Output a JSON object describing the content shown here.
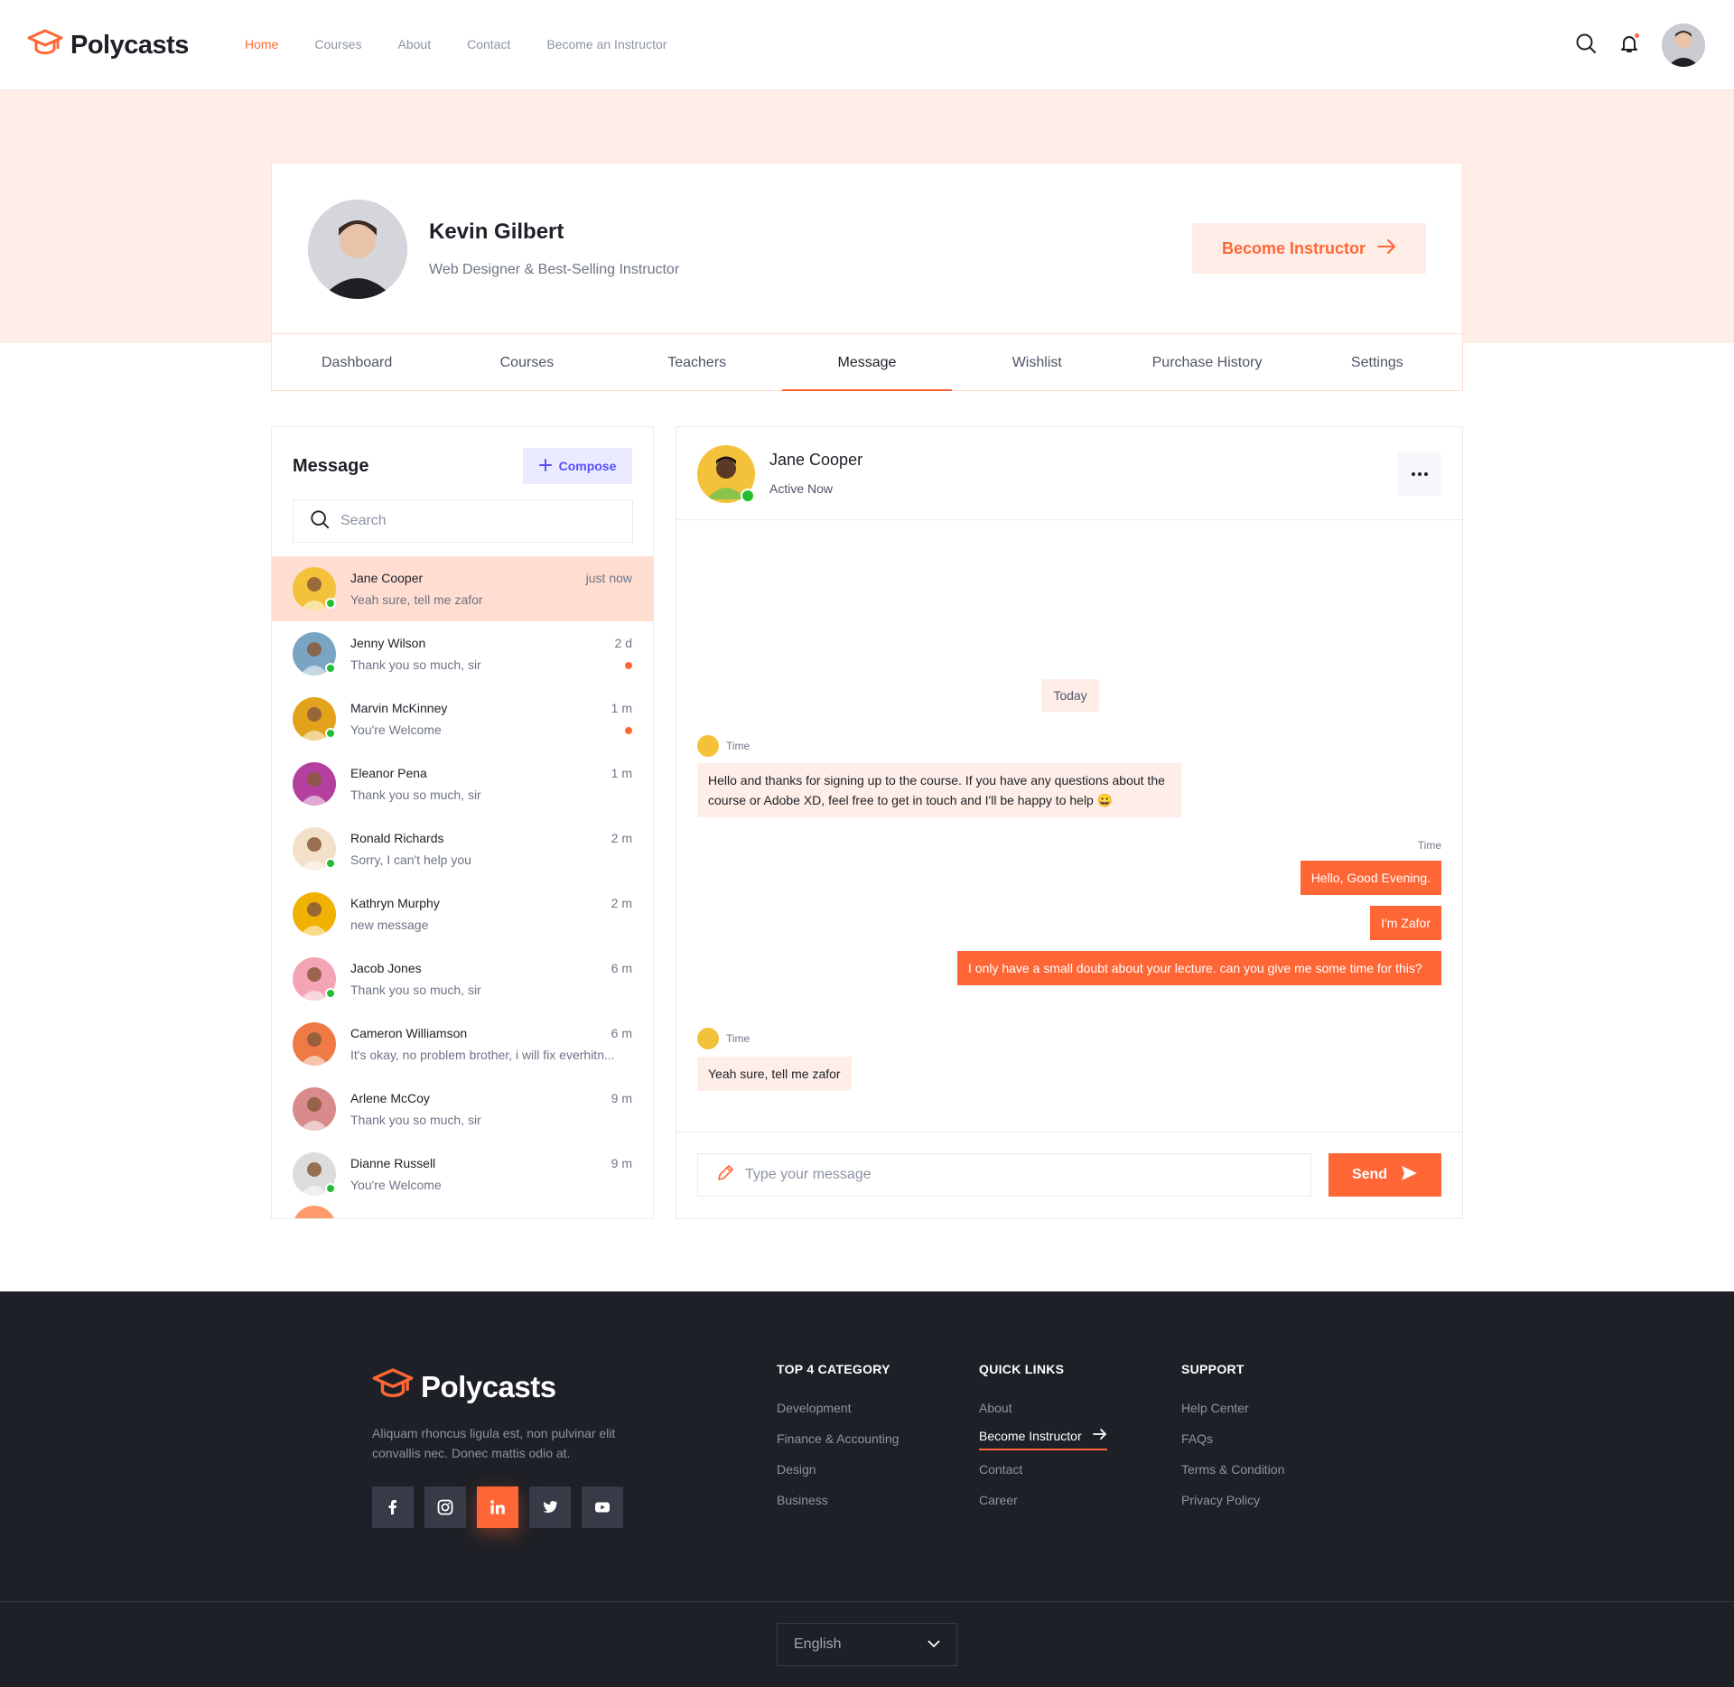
{
  "brand": {
    "name": "Polycasts",
    "accent": "#ff6636"
  },
  "nav": {
    "items": [
      "Home",
      "Courses",
      "About",
      "Contact",
      "Become an Instructor"
    ],
    "active": "Home"
  },
  "header_icons": [
    "search-icon",
    "bell-icon",
    "avatar"
  ],
  "profile": {
    "name": "Kevin Gilbert",
    "role": "Web Designer & Best-Selling Instructor",
    "cta": "Become Instructor"
  },
  "tabs": {
    "items": [
      "Dashboard",
      "Courses",
      "Teachers",
      "Message",
      "Wishlist",
      "Purchase History",
      "Settings"
    ],
    "active": "Message"
  },
  "messages": {
    "title": "Message",
    "compose": "Compose",
    "search_placeholder": "Search",
    "contacts": [
      {
        "name": "Jane Cooper",
        "time": "just now",
        "preview": "Yeah sure, tell me zafor",
        "online": true,
        "unread": false,
        "active": true,
        "color": "#f4c23a"
      },
      {
        "name": "Jenny Wilson",
        "time": "2 d",
        "preview": "Thank you so much, sir",
        "online": true,
        "unread": true,
        "active": false,
        "color": "#7aa5c2"
      },
      {
        "name": "Marvin McKinney",
        "time": "1 m",
        "preview": "You're Welcome",
        "online": true,
        "unread": true,
        "active": false,
        "color": "#e2a21c"
      },
      {
        "name": "Eleanor Pena",
        "time": "1 m",
        "preview": "Thank you so much, sir",
        "online": false,
        "unread": false,
        "active": false,
        "color": "#b53f9e"
      },
      {
        "name": "Ronald Richards",
        "time": "2 m",
        "preview": "Sorry, I can't help you",
        "online": true,
        "unread": false,
        "active": false,
        "color": "#f3e0c8"
      },
      {
        "name": "Kathryn Murphy",
        "time": "2 m",
        "preview": "new message",
        "online": false,
        "unread": false,
        "active": false,
        "color": "#f0b100"
      },
      {
        "name": "Jacob Jones",
        "time": "6 m",
        "preview": "Thank you so much, sir",
        "online": true,
        "unread": false,
        "active": false,
        "color": "#f4a4b4"
      },
      {
        "name": "Cameron Williamson",
        "time": "6 m",
        "preview": "It's okay, no problem brother, i will fix everhitn...",
        "online": false,
        "unread": false,
        "active": false,
        "color": "#ef7a45"
      },
      {
        "name": "Arlene McCoy",
        "time": "9 m",
        "preview": "Thank you so much, sir",
        "online": false,
        "unread": false,
        "active": false,
        "color": "#d98a8a"
      },
      {
        "name": "Dianne Russell",
        "time": "9 m",
        "preview": "You're Welcome",
        "online": true,
        "unread": false,
        "active": false,
        "color": "#dcdcdc"
      }
    ]
  },
  "chat": {
    "name": "Jane Cooper",
    "status": "Active Now",
    "day": "Today",
    "time_label": "Time",
    "incoming_1": "Hello and thanks for signing up to the course. If you have any questions about the course or Adobe XD, feel free to get in touch and I'll be happy to help 😀",
    "outgoing": [
      "Hello, Good Evening.",
      "I'm Zafor",
      "I only have a small doubt about your lecture. can you give me some time for this?"
    ],
    "incoming_2": "Yeah sure, tell me zafor",
    "input_placeholder": "Type your message",
    "send": "Send"
  },
  "footer": {
    "brand": "Polycasts",
    "description": "Aliquam rhoncus ligula est, non pulvinar elit convallis nec. Donec mattis odio at.",
    "socials": [
      "facebook-icon",
      "instagram-icon",
      "linkedin-icon",
      "twitter-icon",
      "youtube-icon"
    ],
    "active_social": "linkedin-icon",
    "columns": [
      {
        "title": "TOP 4 CATEGORY",
        "links": [
          "Development",
          "Finance & Accounting",
          "Design",
          "Business"
        ]
      },
      {
        "title": "QUICK LINKS",
        "links": [
          "About",
          "Become Instructor",
          "Contact",
          "Career"
        ]
      },
      {
        "title": "SUPPORT",
        "links": [
          "Help Center",
          "FAQs",
          "Terms & Condition",
          "Privacy Policy"
        ]
      }
    ],
    "language": "English"
  }
}
